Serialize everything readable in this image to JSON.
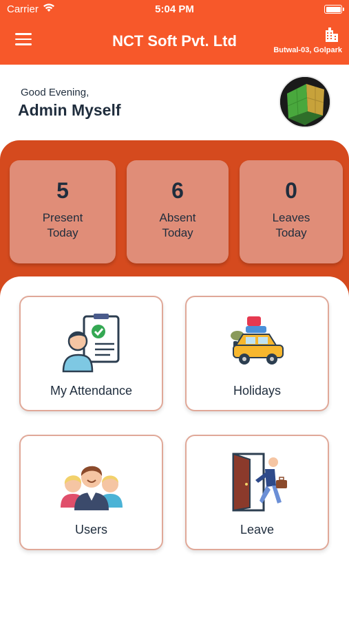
{
  "status_bar": {
    "carrier": "Carrier",
    "time": "5:04 PM"
  },
  "header": {
    "title": "NCT Soft Pvt. Ltd",
    "location": "Butwal-03, Golpark",
    "menu_icon": "hamburger-menu-icon",
    "location_icon": "building-icon"
  },
  "greeting": {
    "text": "Good Evening,",
    "name": "Admin Myself"
  },
  "stats": [
    {
      "value": "5",
      "line1": "Present",
      "line2": "Today"
    },
    {
      "value": "6",
      "line1": "Absent",
      "line2": "Today"
    },
    {
      "value": "0",
      "line1": "Leaves",
      "line2": "Today"
    }
  ],
  "menu": [
    {
      "label": "My Attendance",
      "icon": "attendance-clipboard-icon"
    },
    {
      "label": "Holidays",
      "icon": "holiday-car-icon"
    },
    {
      "label": "Users",
      "icon": "users-group-icon"
    },
    {
      "label": "Leave",
      "icon": "leave-door-icon"
    }
  ],
  "colors": {
    "header": "#f7582a",
    "stats_panel": "#d54a1e",
    "stat_card": "#e08d78",
    "card_border": "#e0a898",
    "text": "#1f2d3d"
  }
}
